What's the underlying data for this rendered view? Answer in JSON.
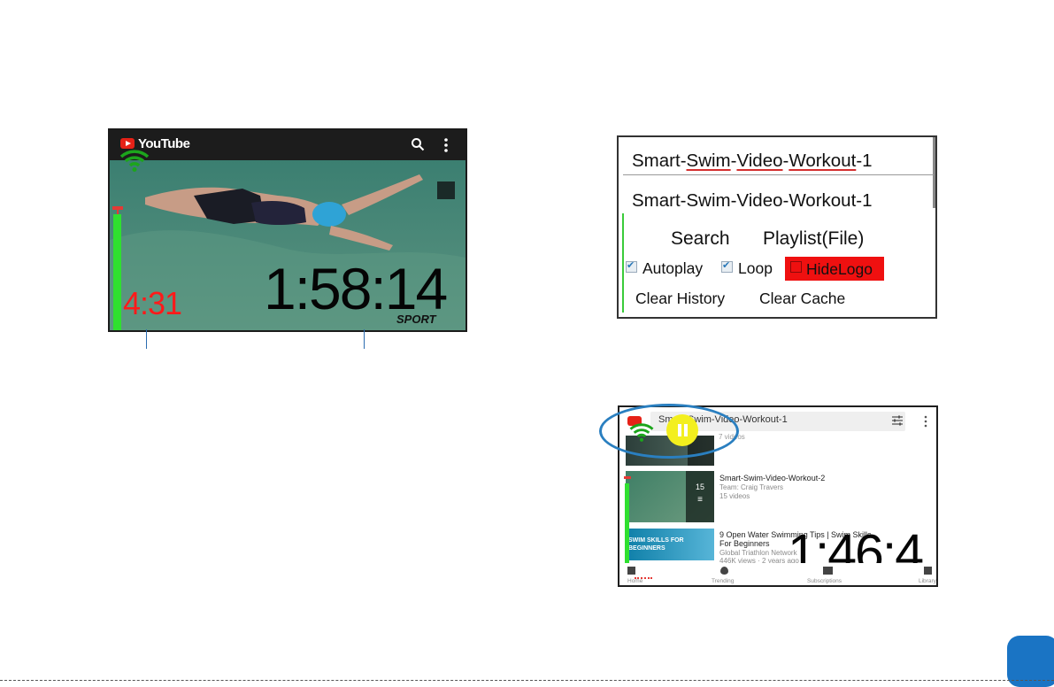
{
  "player": {
    "app_name": "YouTube",
    "elapsed_time": "4:31",
    "remaining_time": "1:58:14",
    "watermark": "SPORT",
    "colors": {
      "timer_bar": "#2fe02f",
      "elapsed": "#ff1a1a",
      "wifi": "#1ca51c"
    }
  },
  "settings": {
    "playlist_id_input": "Smart-Swim-Video-Workout-1",
    "playlist_id_suggestion": "Smart-Swim-Video-Workout-1",
    "search_label": "Search",
    "playlist_label": "Playlist(File)",
    "autoplay_label": "Autoplay",
    "autoplay_checked": true,
    "loop_label": "Loop",
    "loop_checked": true,
    "hidelogo_label": "HideLogo",
    "hidelogo_checked": false,
    "clear_history_label": "Clear History",
    "clear_cache_label": "Clear Cache"
  },
  "playlist_screen": {
    "title": "Smart-Swim-Video-Workout-1",
    "video_count": "7 videos",
    "items": [
      {
        "title": "Smart-Swim-Video-Workout-2",
        "channel": "Team: Craig Travers",
        "count": "15 videos",
        "badge": "15"
      },
      {
        "title": "9 Open Water Swimming Tips | Swim Skills For Beginners",
        "channel": "Global Triathlon Network",
        "meta": "446K views · 2 years ago",
        "thumb_text": "SWIM SKILLS FOR BEGINNERS"
      }
    ],
    "timer": "1:46:4",
    "nav": [
      "Home",
      "Trending",
      "Subscriptions",
      "Library"
    ]
  }
}
